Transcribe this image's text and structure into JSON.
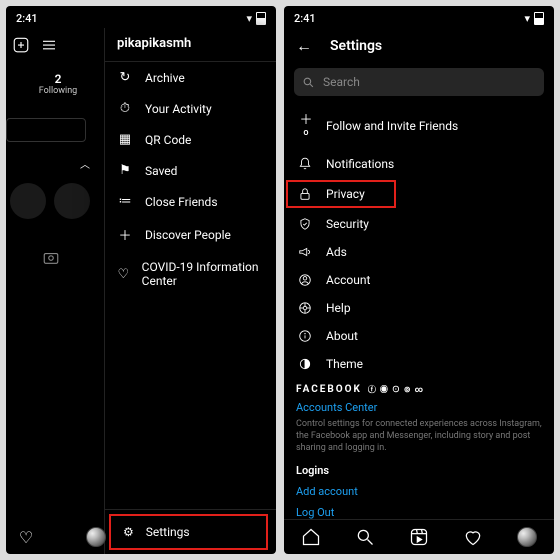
{
  "status": {
    "time": "2:41"
  },
  "left": {
    "username": "pikapikasmh",
    "stat": {
      "num": "2",
      "label": "Following"
    },
    "menu": [
      {
        "icon": "↻",
        "label": "Archive"
      },
      {
        "icon": "⏱",
        "label": "Your Activity"
      },
      {
        "icon": "▦",
        "label": "QR Code"
      },
      {
        "icon": "⚑",
        "label": "Saved"
      },
      {
        "icon": "≔",
        "label": "Close Friends"
      },
      {
        "icon": "＋",
        "label": "Discover People"
      },
      {
        "icon": "♡",
        "label": "COVID-19 Information Center"
      }
    ],
    "settings": {
      "icon": "⚙",
      "label": "Settings"
    }
  },
  "right": {
    "title": "Settings",
    "search_placeholder": "Search",
    "items": [
      {
        "icon": "＋",
        "label": "Follow and Invite Friends"
      },
      {
        "icon": "🔔",
        "label": "Notifications"
      },
      {
        "icon": "🔒",
        "label": "Privacy",
        "highlight": true
      },
      {
        "icon": "✓",
        "label": "Security"
      },
      {
        "icon": "📣",
        "label": "Ads"
      },
      {
        "icon": "◯",
        "label": "Account"
      },
      {
        "icon": "⊕",
        "label": "Help"
      },
      {
        "icon": "ⓘ",
        "label": "About"
      },
      {
        "icon": "◐",
        "label": "Theme"
      }
    ],
    "fb_brand": "FACEBOOK",
    "accounts_center": "Accounts Center",
    "desc": "Control settings for connected experiences across Instagram, the Facebook app and Messenger, including story and post sharing and logging in.",
    "logins_title": "Logins",
    "add_account": "Add account",
    "log_out": "Log Out"
  }
}
